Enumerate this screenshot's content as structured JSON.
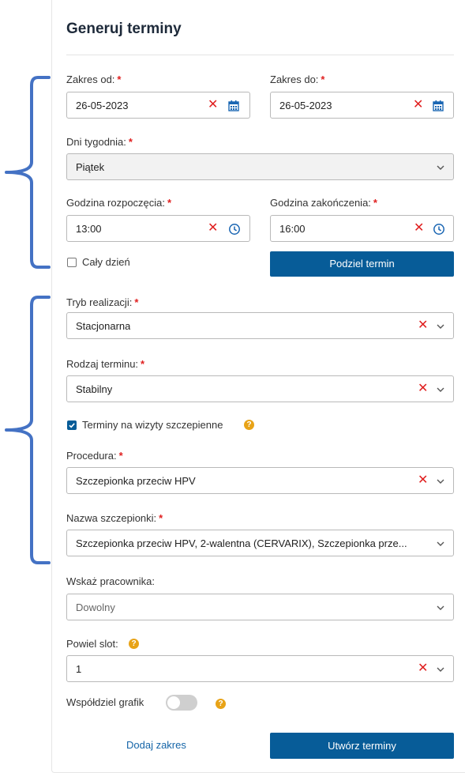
{
  "title": "Generuj terminy",
  "required_mark": "*",
  "date_range": {
    "from_label": "Zakres od:",
    "from_value": "26-05-2023",
    "to_label": "Zakres do:",
    "to_value": "26-05-2023"
  },
  "weekday": {
    "label": "Dni tygodnia:",
    "value": "Piątek"
  },
  "time": {
    "start_label": "Godzina rozpoczęcia:",
    "start_value": "13:00",
    "end_label": "Godzina zakończenia:",
    "end_value": "16:00"
  },
  "all_day": {
    "label": "Cały dzień",
    "checked": false
  },
  "split_button": "Podziel termin",
  "mode": {
    "label": "Tryb realizacji:",
    "value": "Stacjonarna"
  },
  "slot_type": {
    "label": "Rodzaj terminu:",
    "value": "Stabilny"
  },
  "vaccination": {
    "label": "Terminy na wizyty szczepienne",
    "checked": true
  },
  "procedure": {
    "label": "Procedura:",
    "value": "Szczepionka przeciw HPV"
  },
  "vaccine": {
    "label": "Nazwa szczepionki:",
    "value": "Szczepionka przeciw HPV, 2-walentna (CERVARIX), Szczepionka prze..."
  },
  "employee": {
    "label": "Wskaż pracownika:",
    "value": "Dowolny"
  },
  "duplicate": {
    "label": "Powiel slot:",
    "value": "1"
  },
  "share": {
    "label": "Współdziel grafik",
    "on": false
  },
  "footer": {
    "add_range": "Dodaj zakres",
    "create": "Utwórz terminy"
  },
  "colors": {
    "primary": "#075c98",
    "required": "#e02020",
    "clear": "#e01f1f",
    "help": "#e8a317",
    "annotation": "#4472c4"
  },
  "icons": [
    "calendar-icon",
    "clock-icon",
    "clear-icon",
    "chevron-down-icon",
    "help-icon",
    "check-icon"
  ]
}
